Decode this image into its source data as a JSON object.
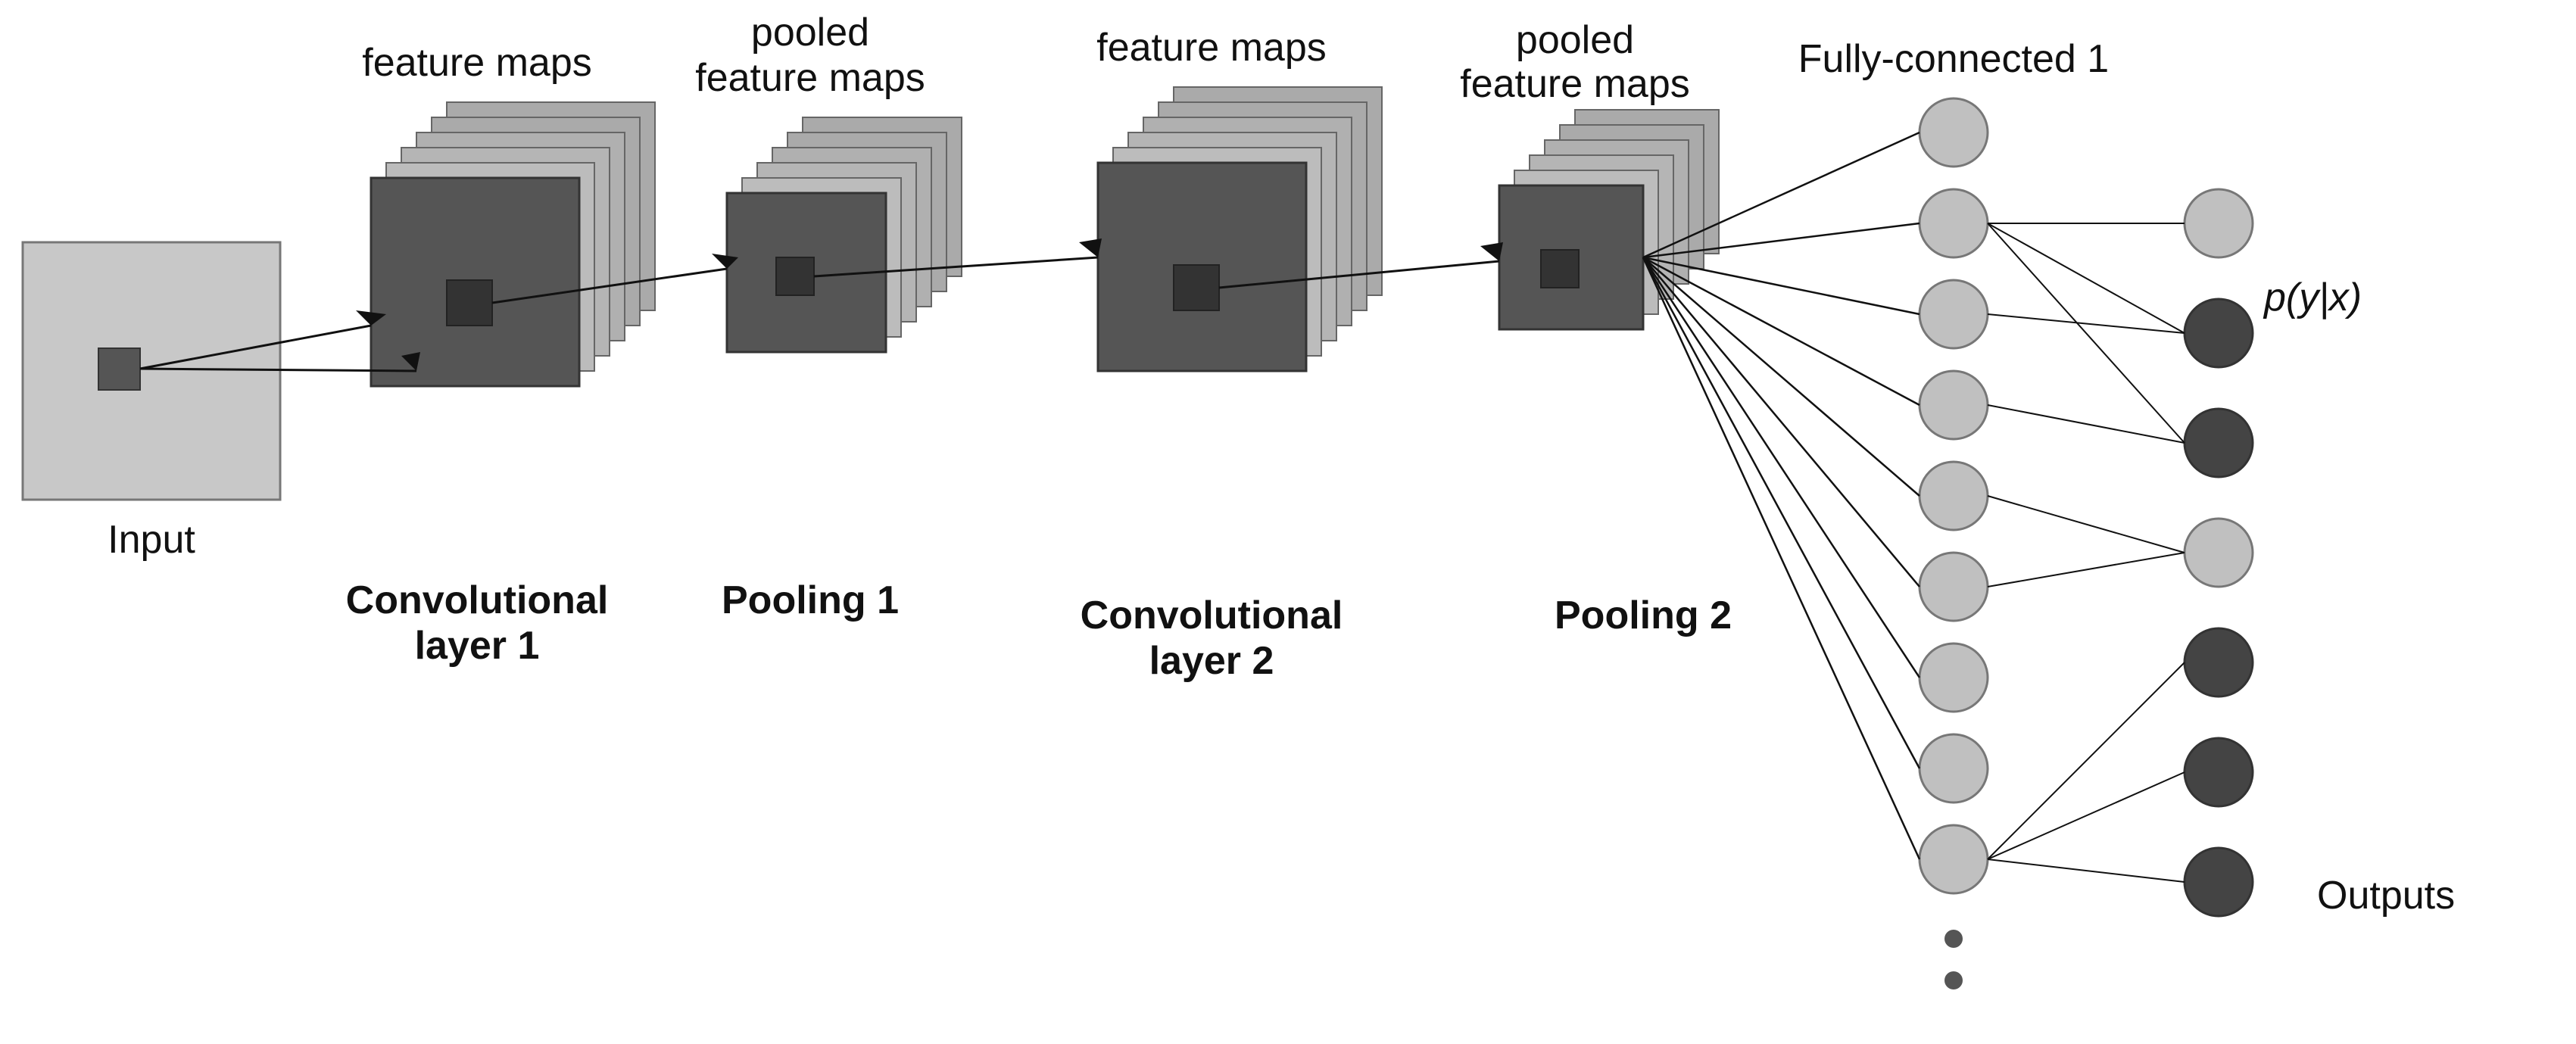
{
  "labels": {
    "input": "Input",
    "feature_maps_1": "feature maps",
    "pooled_feature_maps_1": "pooled\nfeature maps",
    "feature_maps_2": "feature maps",
    "pooled_feature_maps_2": "pooled\nfeature maps",
    "conv1": "Convolutional\nlayer 1",
    "pooling1": "Pooling 1",
    "conv2": "Convolutional\nlayer 2",
    "pooling2": "Pooling 2",
    "fc1": "Fully-connected 1",
    "outputs": "Outputs",
    "py_x": "p(y|x)"
  },
  "colors": {
    "light_gray": "#c8c8c8",
    "mid_gray": "#999999",
    "dark_gray": "#555555",
    "darker_gray": "#444444",
    "darkest": "#333333",
    "neuron_light": "#c0c0c0",
    "neuron_dark": "#444444"
  }
}
